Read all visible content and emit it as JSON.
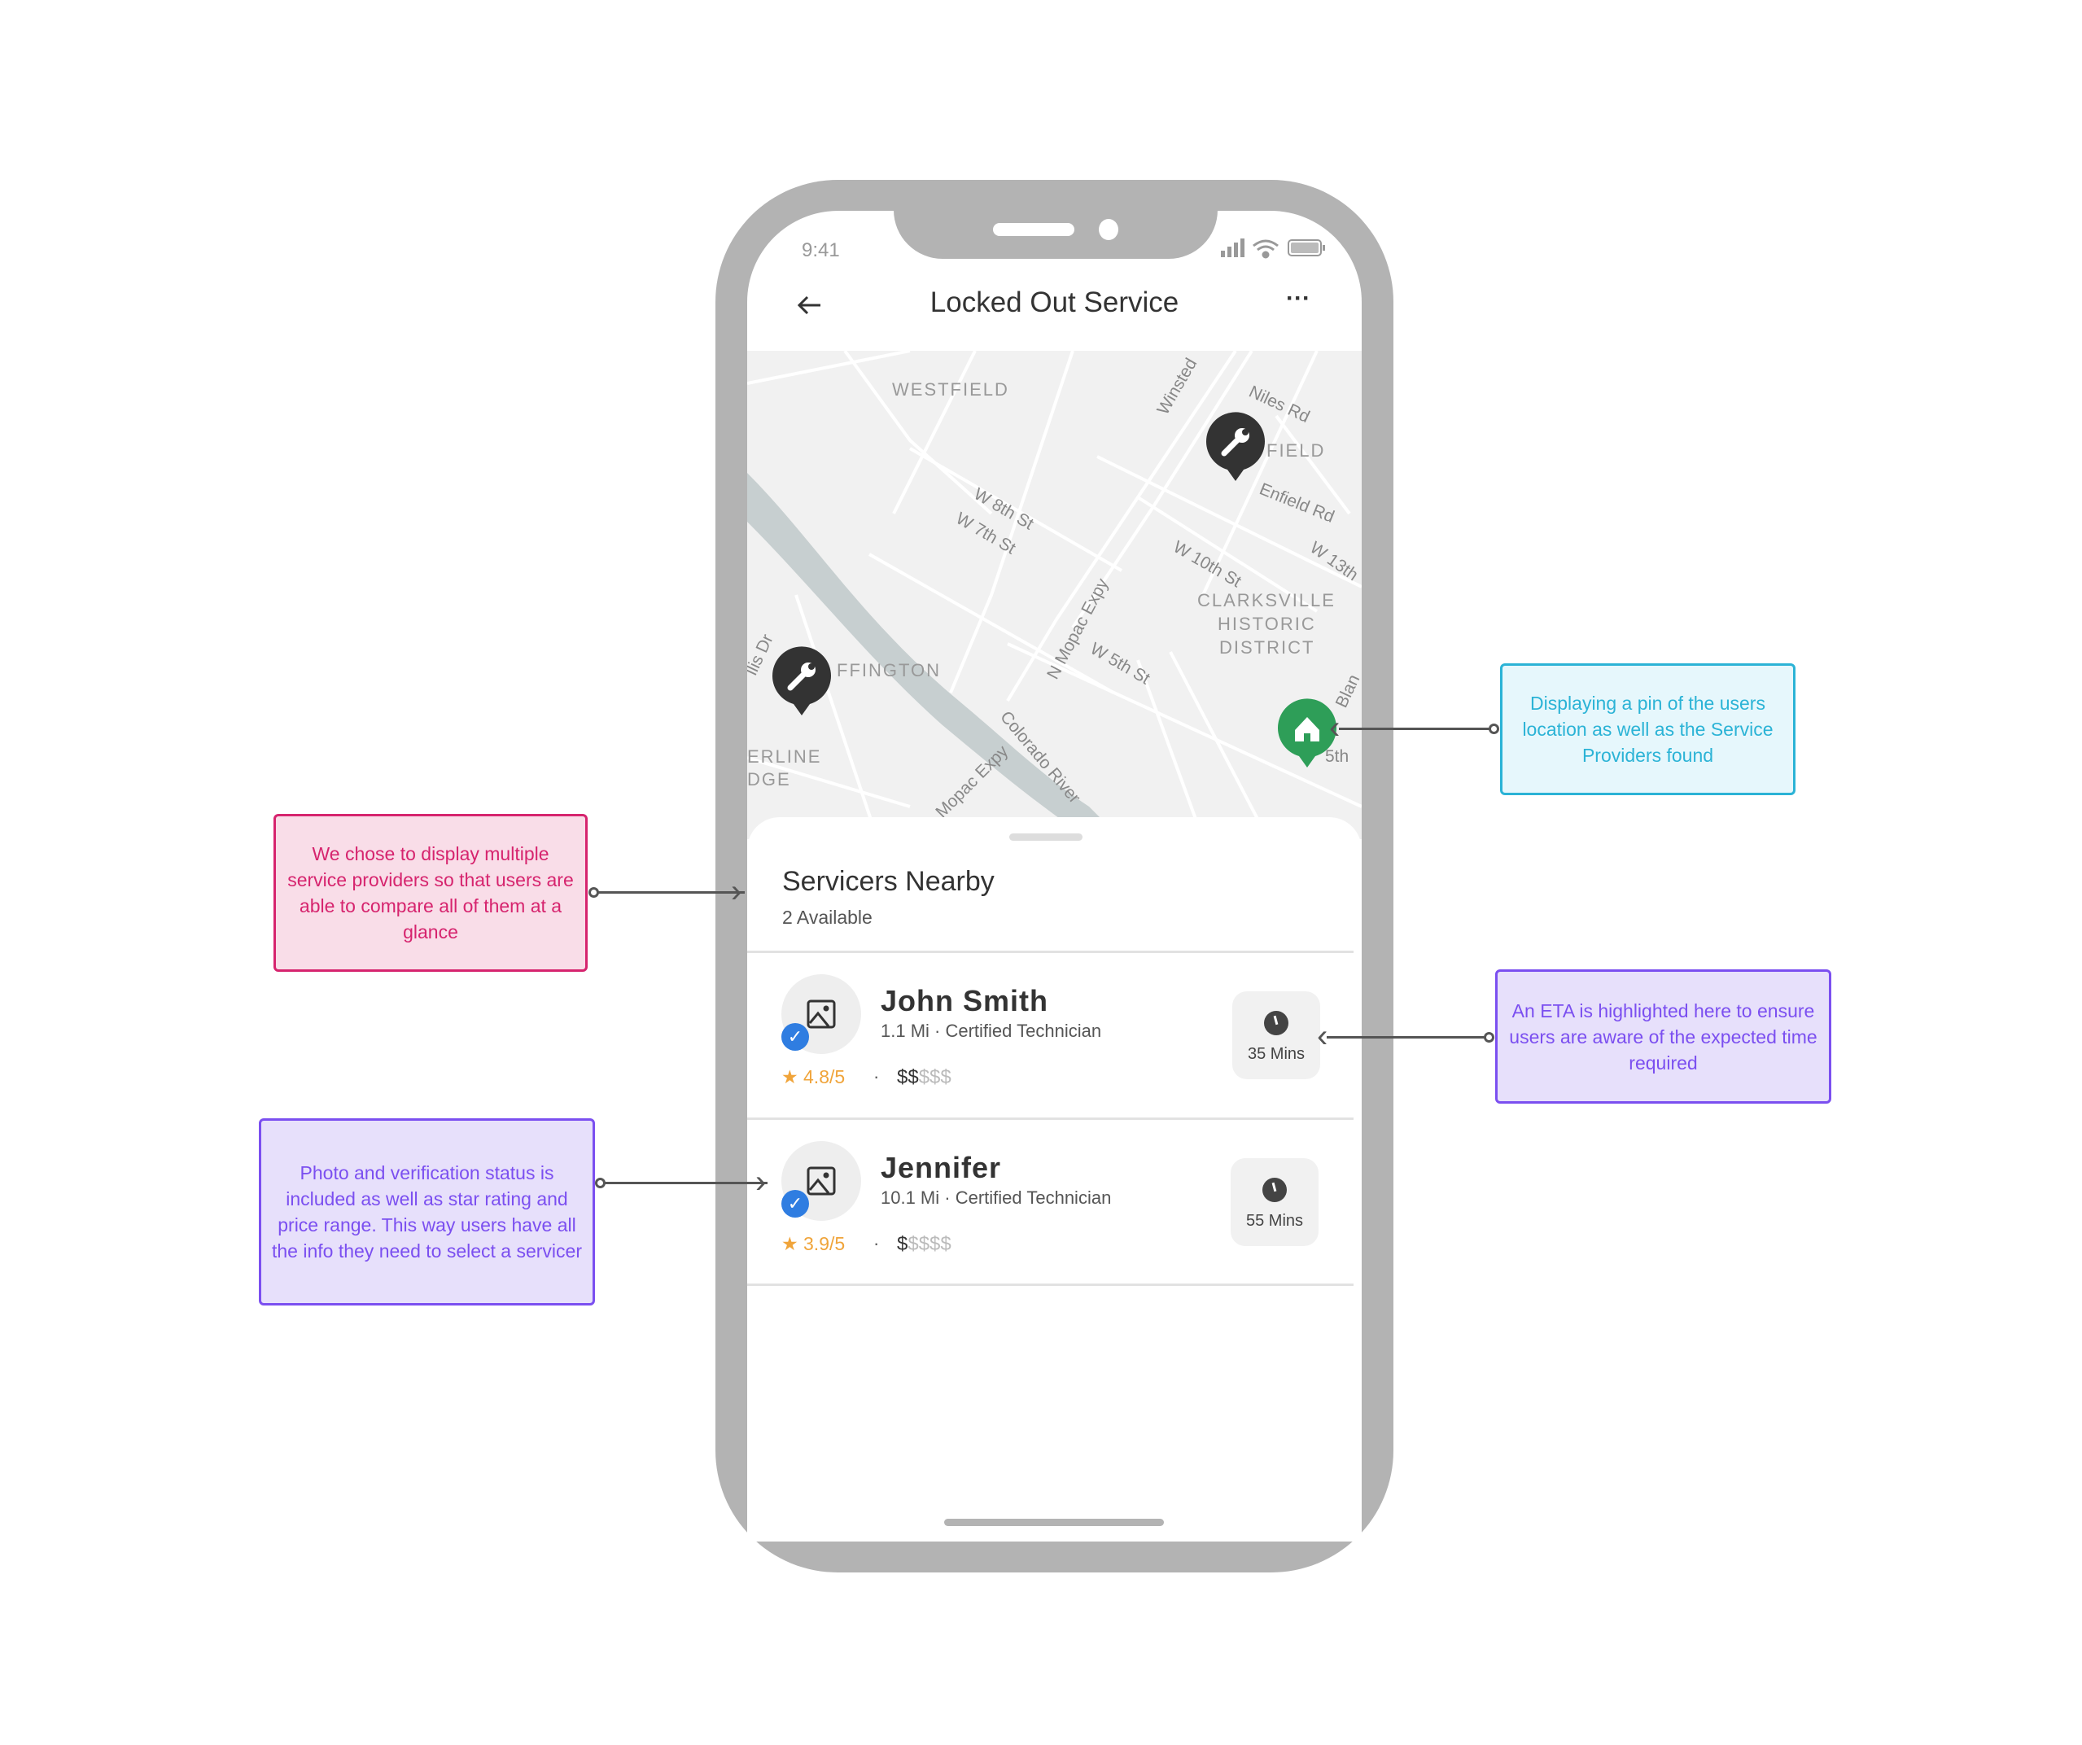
{
  "status_bar": {
    "time": "9:41"
  },
  "header": {
    "title": "Locked Out Service",
    "back_icon": "arrow-left-icon",
    "more_icon": "ellipsis-icon"
  },
  "map": {
    "labels": [
      "WESTFIELD",
      "FIELD",
      "CLARKSVILLE",
      "HISTORIC",
      "DISTRICT",
      "FFINGTON",
      "ERLINE",
      "DGE"
    ],
    "roads": [
      "Niles Rd",
      "Winsted",
      "Enfield Rd",
      "W 8th St",
      "W 7th St",
      "W 10th St",
      "W 13th",
      "N Mopac Expy",
      "W 5th St",
      "Colorado River",
      "Mopac Expy",
      "llis Dr",
      "Blan",
      "5th"
    ],
    "pins": [
      {
        "type": "wrench",
        "color": "#333333"
      },
      {
        "type": "wrench",
        "color": "#333333"
      },
      {
        "type": "home",
        "color": "#2e9e58"
      }
    ]
  },
  "sheet": {
    "title": "Servicers Nearby",
    "subtitle": "2 Available",
    "servicers": [
      {
        "name": "John Smith",
        "distance": "1.1 Mi",
        "role": "Certified Technician",
        "rating": "4.8/5",
        "price_active": "$$",
        "price_inactive": "$$$",
        "eta": "35 Mins",
        "verified": true
      },
      {
        "name": "Jennifer",
        "distance": "10.1 Mi",
        "role": "Certified Technician",
        "rating": "3.9/5",
        "price_active": "$",
        "price_inactive": "$$$$",
        "eta": "55 Mins",
        "verified": true
      }
    ]
  },
  "annotations": {
    "compare": "We chose to display multiple service providers so that users are able to compare all of them at a glance",
    "pins": "Displaying a pin of the users location as well as the Service Providers found",
    "eta": "An ETA is highlighted here to ensure users are aware of the expected time required",
    "photo": "Photo and verification status is included as well as star rating and price range. This way users have all the info they need to select a servicer"
  },
  "colors": {
    "accent_blue": "#2f7de1",
    "rating": "#f0a43a",
    "home_pin": "#2e9e58",
    "note_pink": "#d6246e",
    "note_cyan": "#2bb3d6",
    "note_purple": "#7b4ff0"
  }
}
